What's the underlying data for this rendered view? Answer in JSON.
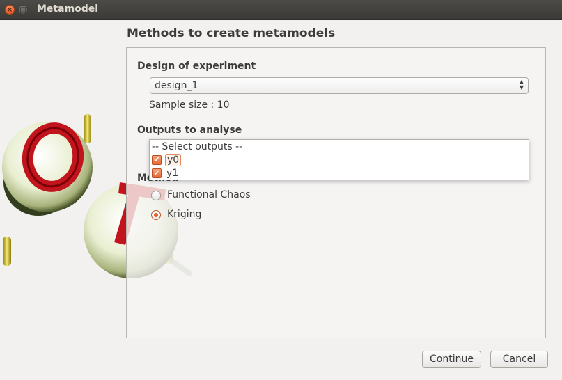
{
  "window": {
    "title": "Metamodel",
    "close_glyph": "×",
    "min_glyph": "□"
  },
  "heading": "Methods to create metamodels",
  "design": {
    "label": "Design of experiment",
    "selected": "design_1",
    "sample_size": "Sample size : 10"
  },
  "outputs": {
    "label": "Outputs to analyse",
    "header": "-- Select outputs --",
    "items": [
      {
        "label": "y0",
        "checked": true
      },
      {
        "label": "y1",
        "checked": true
      }
    ]
  },
  "method": {
    "label": "Method",
    "options": [
      {
        "label": "Functional Chaos",
        "selected": false
      },
      {
        "label": "Kriging",
        "selected": true
      }
    ]
  },
  "buttons": {
    "continue": "Continue",
    "cancel": "Cancel"
  },
  "icons": {
    "check": "✔"
  },
  "colors": {
    "accent": "#e86a36",
    "titlebar": "#3b3a37"
  }
}
